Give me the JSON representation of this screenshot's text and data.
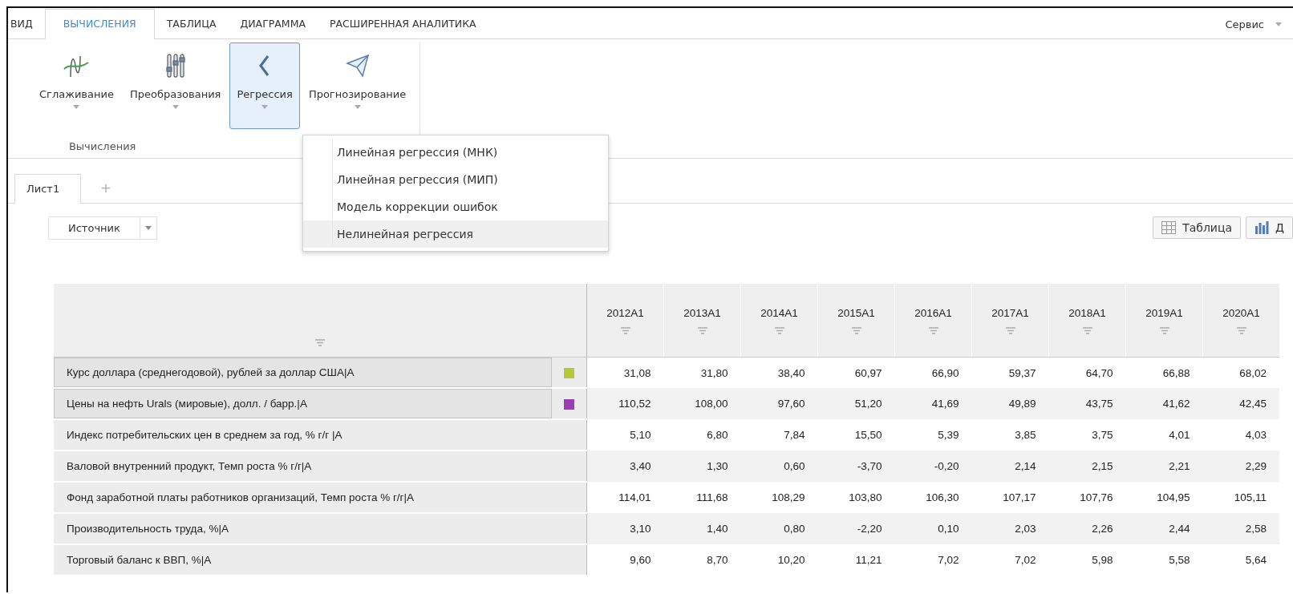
{
  "tabs": [
    {
      "label": "ВИД",
      "selected": false
    },
    {
      "label": "ВЫЧИСЛЕНИЯ",
      "selected": true
    },
    {
      "label": "ТАБЛИЦА",
      "selected": false
    },
    {
      "label": "ДИАГРАММА",
      "selected": false
    },
    {
      "label": "РАСШИРЕННАЯ АНАЛИТИКА",
      "selected": false
    }
  ],
  "service_menu": {
    "label": "Сервис"
  },
  "ribbon": {
    "buttons": [
      {
        "label": "Сглаживание",
        "kind": "smoothing",
        "selected": false
      },
      {
        "label": "Преобразования",
        "kind": "transform",
        "selected": false
      },
      {
        "label": "Регрессия",
        "kind": "regression",
        "selected": true
      },
      {
        "label": "Прогнозирование",
        "kind": "forecast",
        "selected": false
      }
    ],
    "group_label": "Вычисления"
  },
  "dropdown": {
    "items": [
      {
        "label": "Линейная регрессия (МНК)",
        "selected": false
      },
      {
        "label": "Линейная регрессия (МИП)",
        "selected": false
      },
      {
        "label": "Модель коррекции ошибок",
        "selected": false
      },
      {
        "label": "Нелинейная регрессия",
        "selected": true
      }
    ]
  },
  "sheets": {
    "tabs": [
      {
        "label": "Лист1",
        "selected": true
      }
    ],
    "add": "+"
  },
  "source": {
    "label": "Источник"
  },
  "view_buttons": [
    {
      "label": "Таблица",
      "kind": "table"
    },
    {
      "label": "Д",
      "kind": "chart"
    }
  ],
  "table": {
    "columns": [
      "2012A1",
      "2013A1",
      "2014A1",
      "2015A1",
      "2016A1",
      "2017A1",
      "2018A1",
      "2019A1",
      "2020A1"
    ],
    "rows": [
      {
        "label": "Курс доллара (среднегодовой), рублей за доллар США|A",
        "color": "#b5c935",
        "selected": true,
        "values": [
          "31,08",
          "31,80",
          "38,40",
          "60,97",
          "66,90",
          "59,37",
          "64,70",
          "66,88",
          "68,02"
        ]
      },
      {
        "label": "Цены на нефть Urals (мировые), долл. / барр.|A",
        "color": "#9b3fb5",
        "selected": true,
        "values": [
          "110,52",
          "108,00",
          "97,60",
          "51,20",
          "41,69",
          "49,89",
          "43,75",
          "41,62",
          "42,45"
        ]
      },
      {
        "label": "Индекс  потребительских цен в среднем за год, % г/г |A",
        "selected": false,
        "values": [
          "5,10",
          "6,80",
          "7,84",
          "15,50",
          "5,39",
          "3,85",
          "3,75",
          "4,01",
          "4,03"
        ]
      },
      {
        "label": "Валовой внутренний продукт, Темп роста % г/г|A",
        "selected": false,
        "values": [
          "3,40",
          "1,30",
          "0,60",
          "-3,70",
          "-0,20",
          "2,14",
          "2,15",
          "2,21",
          "2,29"
        ]
      },
      {
        "label": "Фонд заработной платы работников организаций, Темп роста % г/г|A",
        "selected": false,
        "values": [
          "114,01",
          "111,68",
          "108,29",
          "103,80",
          "106,30",
          "107,17",
          "107,76",
          "104,95",
          "105,11"
        ]
      },
      {
        "label": "Производительность труда, %|A",
        "selected": false,
        "values": [
          "3,10",
          "1,40",
          "0,80",
          "-2,20",
          "0,10",
          "2,03",
          "2,26",
          "2,44",
          "2,58"
        ]
      },
      {
        "label": "Торговый баланс к ВВП, %|A",
        "selected": false,
        "values": [
          "9,60",
          "8,70",
          "10,20",
          "11,21",
          "7,02",
          "7,02",
          "5,98",
          "5,58",
          "5,64"
        ]
      }
    ]
  }
}
